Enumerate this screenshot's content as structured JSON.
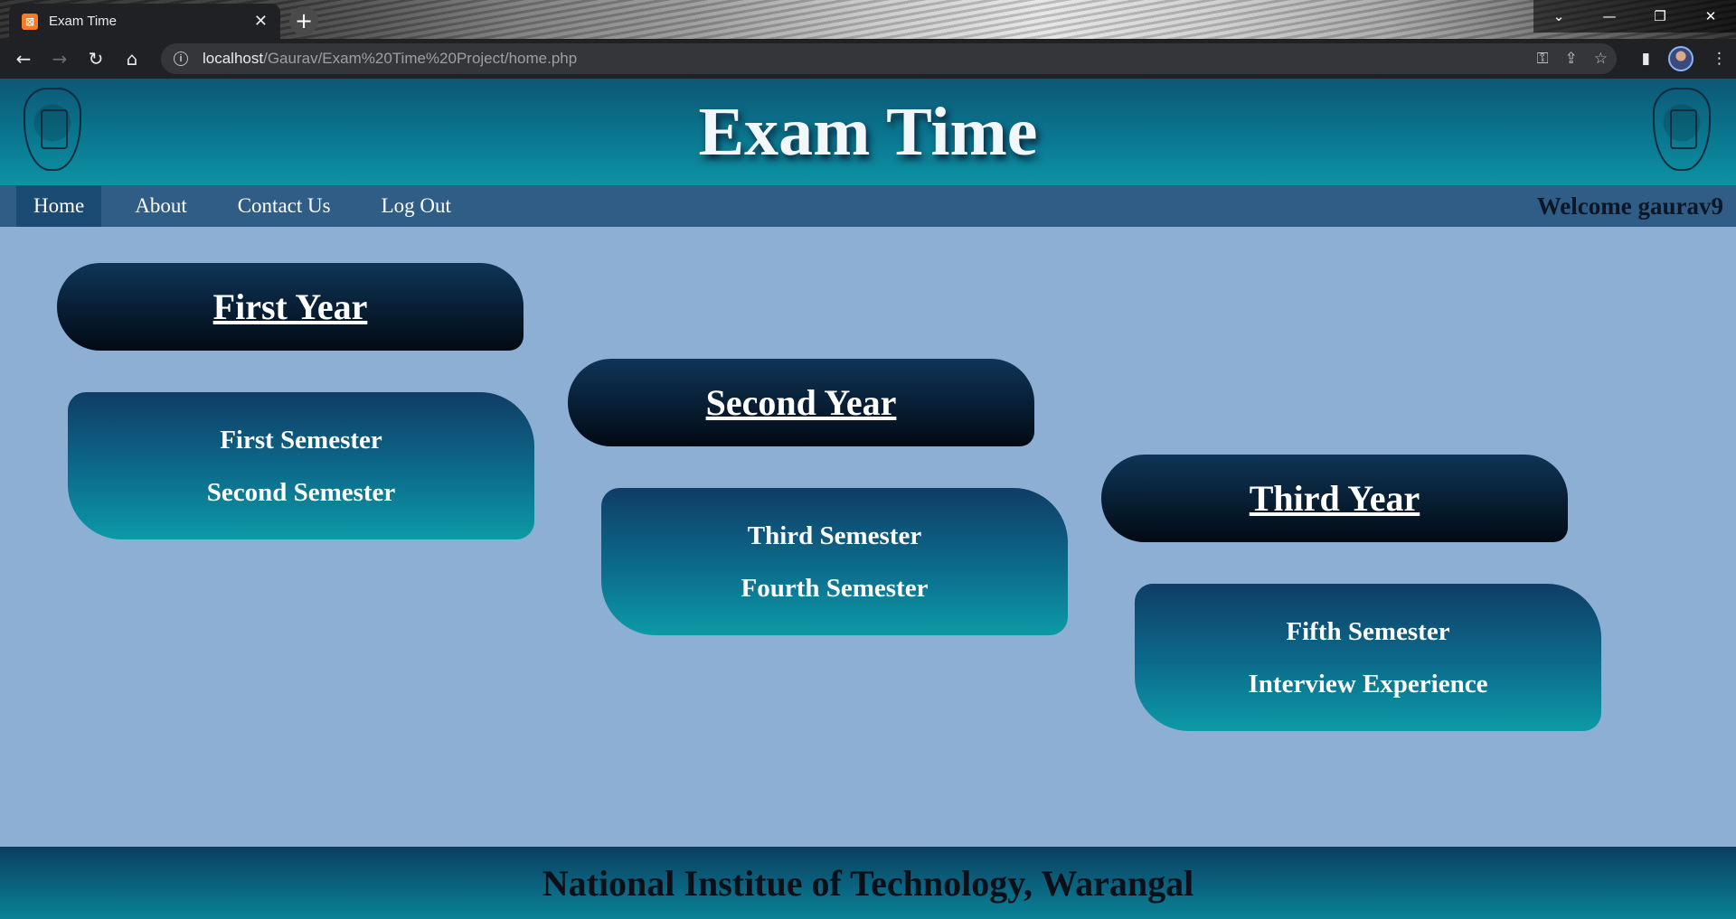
{
  "browser": {
    "tab_title": "Exam Time",
    "favicon_glyph": "⊠",
    "tab_close": "✕",
    "new_tab": "+",
    "url_host": "localhost",
    "url_path": "/Gaurav/Exam%20Time%20Project/home.php",
    "window_controls": [
      "⌄",
      "—",
      "❐",
      "✕"
    ],
    "nav_icons": [
      "arrow-left-icon",
      "arrow-right-icon",
      "reload-icon",
      "home-icon"
    ]
  },
  "header": {
    "title": "Exam Time"
  },
  "nav": {
    "items": [
      "Home",
      "About",
      "Contact Us",
      "Log Out"
    ],
    "active": "Home",
    "welcome": "Welcome gaurav9"
  },
  "years": [
    {
      "title": "First Year",
      "semesters": [
        "First Semester",
        "Second Semester"
      ]
    },
    {
      "title": "Second Year",
      "semesters": [
        "Third Semester",
        "Fourth Semester"
      ]
    },
    {
      "title": "Third Year",
      "semesters": [
        "Fifth Semester",
        "Interview Experience"
      ]
    }
  ],
  "footer": {
    "text": "National Institue of Technology, Warangal"
  },
  "colors": {
    "page_bg": "#8eafd4",
    "navbar": "#2f5d86",
    "header_gradient_top": "#0d5775",
    "pill_dark": "#020a14",
    "box_teal": "#0c9aa6"
  }
}
